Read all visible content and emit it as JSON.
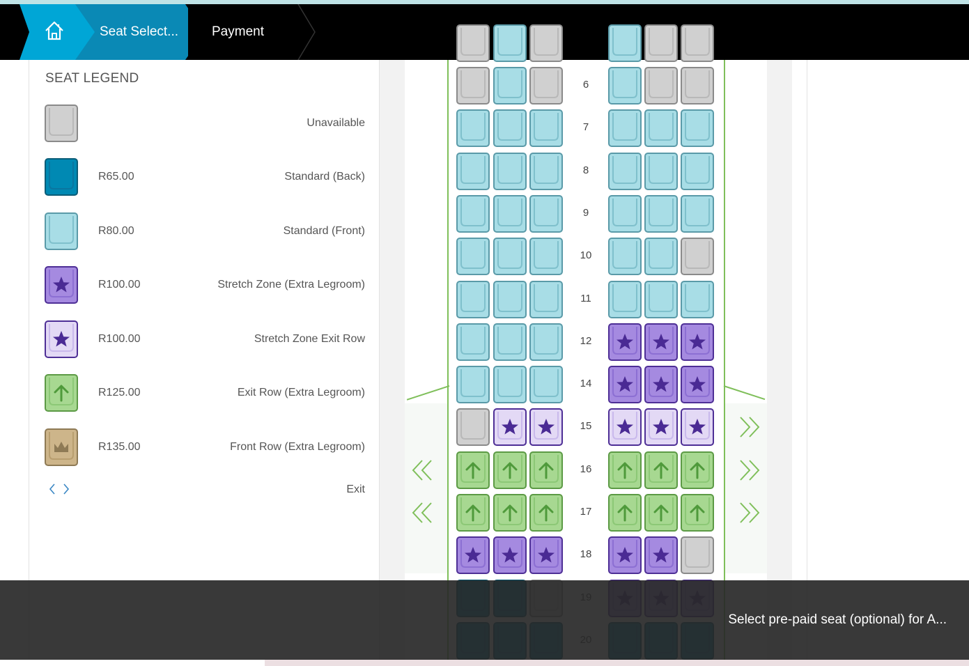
{
  "breadcrumb": {
    "home_icon": "home-icon",
    "items": [
      "Seat Select...",
      "Payment"
    ]
  },
  "legend": {
    "title": "SEAT LEGEND",
    "items": [
      {
        "type": "unavailable",
        "price": "",
        "label": "Unavailable"
      },
      {
        "type": "standard-back",
        "price": "R65.00",
        "label": "Standard (Back)"
      },
      {
        "type": "standard-front",
        "price": "R80.00",
        "label": "Standard (Front)"
      },
      {
        "type": "stretch",
        "price": "R100.00",
        "label": "Stretch Zone (Extra Legroom)"
      },
      {
        "type": "stretch-exit",
        "price": "R100.00",
        "label": "Stretch Zone Exit Row"
      },
      {
        "type": "exit",
        "price": "R125.00",
        "label": "Exit Row (Extra Legroom)"
      },
      {
        "type": "front",
        "price": "R135.00",
        "label": "Front Row (Extra Legroom)"
      }
    ],
    "exit_label": "Exit"
  },
  "seat_map": {
    "rows": [
      {
        "num": "6",
        "left": [
          "unavailable",
          "standard-front",
          "unavailable"
        ],
        "right": [
          "standard-front",
          "unavailable",
          "unavailable"
        ]
      },
      {
        "num": "7",
        "left": [
          "standard-front",
          "standard-front",
          "standard-front"
        ],
        "right": [
          "standard-front",
          "standard-front",
          "standard-front"
        ]
      },
      {
        "num": "8",
        "left": [
          "standard-front",
          "standard-front",
          "standard-front"
        ],
        "right": [
          "standard-front",
          "standard-front",
          "standard-front"
        ]
      },
      {
        "num": "9",
        "left": [
          "standard-front",
          "standard-front",
          "standard-front"
        ],
        "right": [
          "standard-front",
          "standard-front",
          "standard-front"
        ]
      },
      {
        "num": "10",
        "left": [
          "standard-front",
          "standard-front",
          "standard-front"
        ],
        "right": [
          "standard-front",
          "standard-front",
          "unavailable"
        ]
      },
      {
        "num": "11",
        "left": [
          "standard-front",
          "standard-front",
          "standard-front"
        ],
        "right": [
          "standard-front",
          "standard-front",
          "standard-front"
        ]
      },
      {
        "num": "12",
        "left": [
          "standard-front",
          "standard-front",
          "standard-front"
        ],
        "right": [
          "stretch",
          "stretch",
          "stretch"
        ]
      },
      {
        "num": "14",
        "left": [
          "standard-front",
          "standard-front",
          "standard-front"
        ],
        "right": [
          "stretch",
          "stretch",
          "stretch"
        ]
      },
      {
        "num": "15",
        "left": [
          "unavailable",
          "stretch-exit",
          "stretch-exit"
        ],
        "right": [
          "stretch-exit",
          "stretch-exit",
          "stretch-exit"
        ],
        "exit": {
          "left": false,
          "right": true
        }
      },
      {
        "num": "16",
        "left": [
          "exit",
          "exit",
          "exit"
        ],
        "right": [
          "exit",
          "exit",
          "exit"
        ],
        "exit": {
          "left": true,
          "right": true
        }
      },
      {
        "num": "17",
        "left": [
          "exit",
          "exit",
          "exit"
        ],
        "right": [
          "exit",
          "exit",
          "exit"
        ],
        "exit": {
          "left": true,
          "right": true
        }
      },
      {
        "num": "18",
        "left": [
          "stretch",
          "stretch",
          "stretch"
        ],
        "right": [
          "stretch",
          "stretch",
          "unavailable"
        ]
      },
      {
        "num": "19",
        "left": [
          "standard-back",
          "standard-back",
          "unavailable"
        ],
        "right": [
          "stretch",
          "stretch",
          "stretch"
        ]
      },
      {
        "num": "20",
        "left": [
          "standard-back",
          "standard-back",
          "standard-back"
        ],
        "right": [
          "standard-back",
          "standard-back",
          "standard-back"
        ]
      }
    ]
  },
  "toast": {
    "message": "Select pre-paid seat (optional) for A..."
  },
  "colors": {
    "unavailable": "#d0d0d0",
    "standard_back": "#0089b3",
    "standard_front": "#a8dde6",
    "stretch": "#a58ae0",
    "stretch_exit": "#e3d9f5",
    "exit": "#a7d891",
    "front": "#cdb58a",
    "breadcrumb_active": "#0a89b5",
    "breadcrumb_home": "#00a6d6",
    "cabin_wall": "#7fbf5a"
  }
}
